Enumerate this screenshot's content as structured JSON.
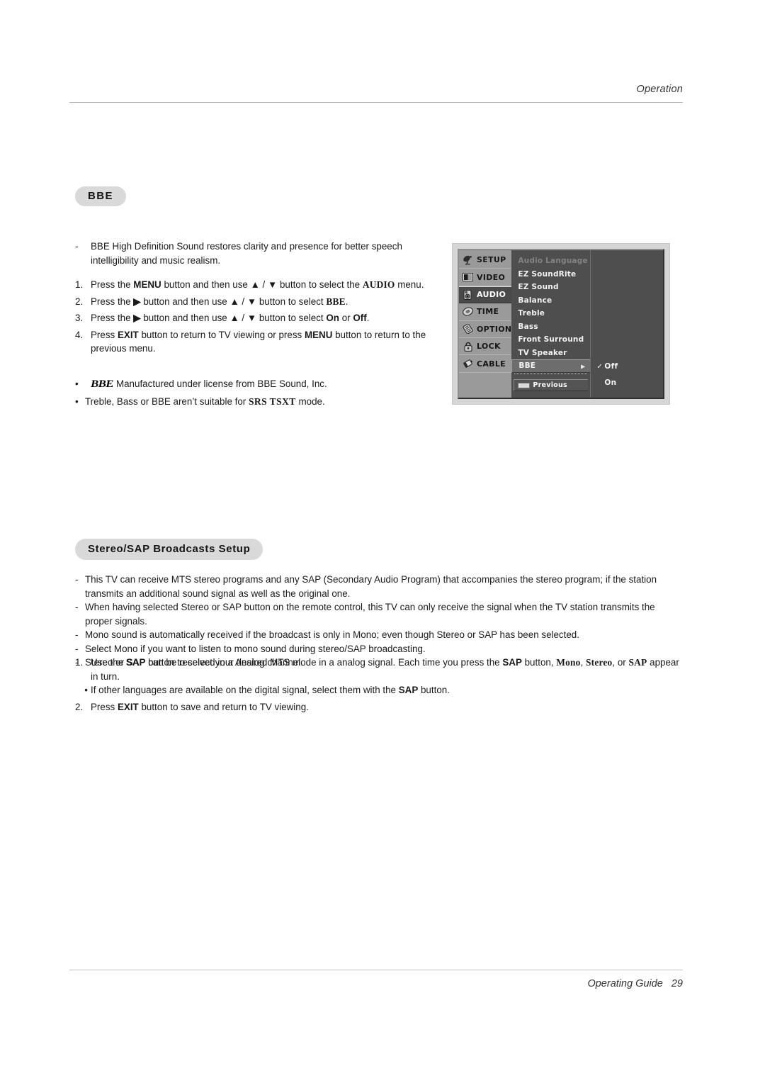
{
  "header": {
    "title": "Operation"
  },
  "footer": {
    "guide": "Operating Guide",
    "page": "29"
  },
  "sections": {
    "bbe": {
      "heading": "BBE",
      "intro_dash": "-",
      "intro": "BBE High Definition Sound restores clarity and presence for better speech intelligibility and music realism.",
      "steps": [
        {
          "num": "1.",
          "t1": "Press the ",
          "b1": "MENU",
          "t2": " button and then use ",
          "arrows": "▲ / ▼",
          "t3": " button to select the ",
          "b2": "AUDIO",
          "t4": " menu."
        },
        {
          "num": "2.",
          "t1": "Press the ",
          "b1": "▶",
          "t2": " button and then use ",
          "arrows": "▲ / ▼",
          "t3": " button to select ",
          "b2": "BBE",
          "t4": "."
        },
        {
          "num": "3.",
          "t1": "Press the ",
          "b1": "▶",
          "t2": " button and then use ",
          "arrows": "▲ / ▼",
          "t3": " button to select ",
          "b2": "On",
          "t3b": " or ",
          "b3": "Off",
          "t4": "."
        },
        {
          "num": "4.",
          "t1": "Press ",
          "b1": "EXIT",
          "t2": " button to return to TV viewing or press ",
          "b2": "MENU",
          "t3": " button to return to the previous menu."
        }
      ],
      "notes": [
        {
          "bullet": "•",
          "mark": "BBE",
          "text": ". Manufactured under license from BBE Sound, Inc."
        },
        {
          "bullet": "•",
          "pre": "Treble, Bass or BBE aren’t suitable for ",
          "mark": "SRS TSXT",
          "post": " mode."
        }
      ]
    },
    "stereo_sap": {
      "heading": "Stereo/SAP Broadcasts Setup",
      "dashes": [
        "This TV can receive MTS stereo programs and any SAP (Secondary Audio Program) that accompanies the stereo program; if the station transmits an additional sound signal as well as the original one.",
        "When having selected Stereo or SAP button on the remote control, this TV can only receive the signal when the TV station transmits the proper signals.",
        "Mono sound is automatically received if the broadcast is only in Mono; even though Stereo or SAP has been selected.",
        "Select Mono if you want to listen to mono sound during stereo/SAP broadcasting.",
        "Stereo or SAP can be received in a Analog channel."
      ],
      "dash_marker": "-",
      "step1": {
        "num": "1.",
        "t1": "Use the ",
        "b1": "SAP",
        "t2": " button to select your desired MTS mode in a analog signal. Each time you press the ",
        "b2": "SAP",
        "t3": " button, ",
        "b3": "Mono",
        "t4": ", ",
        "b4": "Stereo",
        "t5": ", or ",
        "b5": "SAP",
        "t6": " appear in turn."
      },
      "substep": {
        "bullet": "•",
        "t1": "If other languages are available on the digital signal, select them with the ",
        "b1": "SAP",
        "t2": " button."
      },
      "step2": {
        "num": "2.",
        "t1": "Press ",
        "b1": "EXIT",
        "t2": " button to save and return to TV viewing."
      }
    }
  },
  "osd": {
    "tabs": [
      {
        "label": "SETUP",
        "icon": "satellite-dish-icon",
        "active": false
      },
      {
        "label": "VIDEO",
        "icon": "monitor-icon",
        "active": false
      },
      {
        "label": "AUDIO",
        "icon": "speaker-icon",
        "active": true
      },
      {
        "label": "TIME",
        "icon": "clock-icon",
        "active": false
      },
      {
        "label": "OPTION",
        "icon": "sliders-icon",
        "active": false
      },
      {
        "label": "LOCK",
        "icon": "padlock-icon",
        "active": false
      },
      {
        "label": "CABLE",
        "icon": "cable-plug-icon",
        "active": false
      }
    ],
    "items": [
      {
        "label": "Audio Language",
        "state": "disabled"
      },
      {
        "label": "EZ SoundRite",
        "state": "normal"
      },
      {
        "label": "EZ Sound",
        "state": "normal"
      },
      {
        "label": "Balance",
        "state": "normal"
      },
      {
        "label": "Treble",
        "state": "normal"
      },
      {
        "label": "Bass",
        "state": "normal"
      },
      {
        "label": "Front Surround",
        "state": "normal"
      },
      {
        "label": "TV Speaker",
        "state": "normal"
      },
      {
        "label": "BBE",
        "state": "selected",
        "caret": "▶"
      }
    ],
    "previous": {
      "label": "Previous",
      "key": "MENU"
    },
    "options": [
      {
        "label": "Off",
        "checked": true,
        "check": "✓"
      },
      {
        "label": "On",
        "checked": false,
        "check": ""
      }
    ]
  },
  "colors": {
    "pill_bg": "#d9d9d9",
    "rule": "#b9b0b0",
    "osd_frame": "#d6d6d6",
    "osd_body": "#4e4e4e",
    "osd_sidebar": "#9a9a9a",
    "osd_active_tab": "#4a4a4a",
    "osd_selected_row": "#6d6d6d"
  }
}
